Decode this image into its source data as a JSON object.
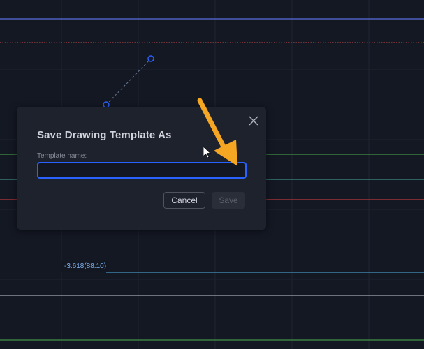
{
  "dialog": {
    "title": "Save Drawing Template As",
    "field_label": "Template name:",
    "input_value": "",
    "input_placeholder": "",
    "cancel_label": "Cancel",
    "save_label": "Save",
    "close_icon": "close-icon"
  },
  "chart": {
    "level_label": "-3.618(88.10)",
    "colors": {
      "background": "#141823",
      "grid": "#1f2430",
      "line_blue": "#5b6ee0",
      "line_red_dotted": "#d04b4b",
      "line_green": "#4caf50",
      "line_teal": "#4aa8a0",
      "line_red": "#e04040",
      "line_lightblue": "#4fb3e8",
      "line_light": "#c9ccd4",
      "trendline": "#2962ff"
    }
  },
  "annotation": {
    "arrow_color": "#f5a623",
    "arrow_icon": "arrow-pointer-icon",
    "cursor_icon": "mouse-cursor-icon"
  },
  "accent_color": "#2962ff"
}
